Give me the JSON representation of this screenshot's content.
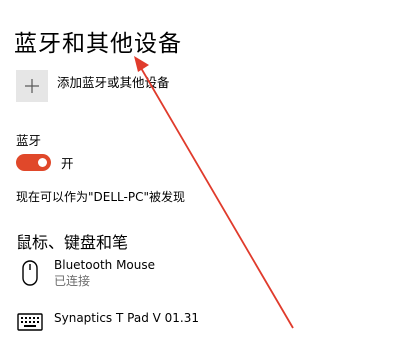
{
  "page": {
    "title": "蓝牙和其他设备"
  },
  "add_device": {
    "icon": "plus-icon",
    "label": "添加蓝牙或其他设备"
  },
  "bluetooth": {
    "section_label": "蓝牙",
    "toggle_on": true,
    "toggle_state_label": "开",
    "toggle_color": "#e0482a",
    "discoverable_text": "现在可以作为\"DELL-PC\"被发现"
  },
  "mouse_keyboard_pen": {
    "section_title": "鼠标、键盘和笔",
    "devices": [
      {
        "name": "Bluetooth Mouse",
        "status": "已连接",
        "icon": "mouse-icon"
      },
      {
        "name": "Synaptics T Pad V 01.31",
        "status": "",
        "icon": "keyboard-icon"
      }
    ]
  },
  "annotation": {
    "color": "#e03b2c",
    "shape": "arrow pointing to add-device button"
  }
}
